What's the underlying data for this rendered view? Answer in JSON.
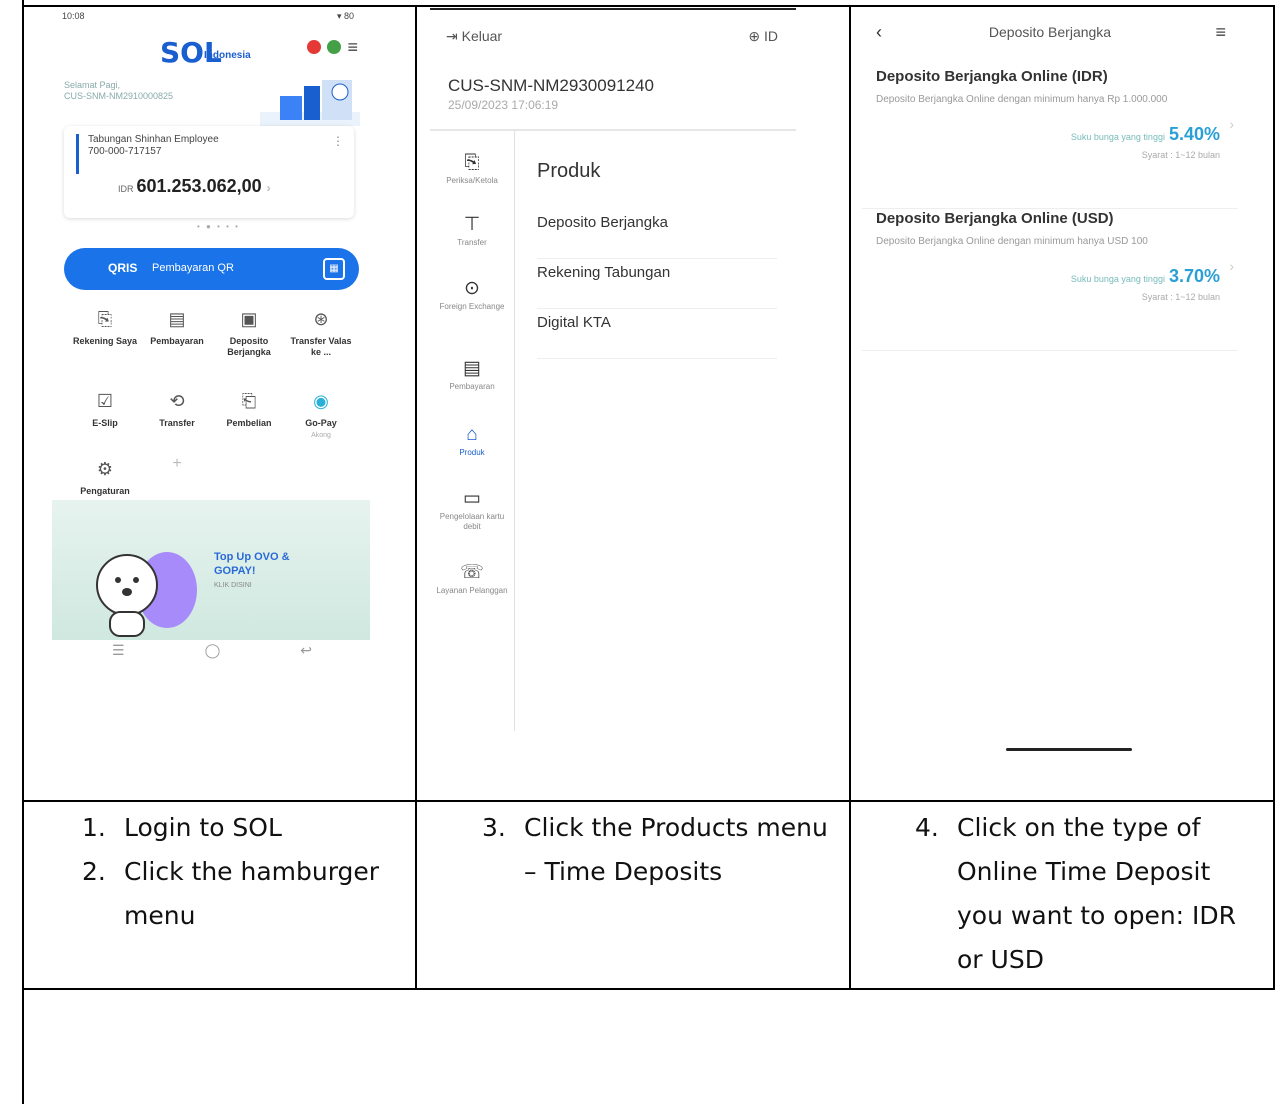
{
  "panel1": {
    "status_time": "10:08",
    "status_right": "▾ 80",
    "logo": "SOL",
    "logo_sub": "Indonesia",
    "greeting": "Selamat Pagi,",
    "user_id": "CUS-SNM-NM2910000825",
    "account_name": "Tabungan Shinhan Employee",
    "account_no": "700-000-717157",
    "currency": "IDR",
    "balance": "601.253.062,00",
    "qris_label": "QRIS",
    "qr_label": "Pembayaran QR",
    "menu": [
      {
        "label": "Rekening Saya",
        "icon": "search-doc-icon"
      },
      {
        "label": "Pembayaran",
        "icon": "bill-icon"
      },
      {
        "label": "Deposito Berjangka",
        "icon": "deposit-icon"
      },
      {
        "label": "Transfer Valas ke ...",
        "icon": "fx-icon"
      },
      {
        "label": "E-Slip",
        "icon": "checkbox-icon"
      },
      {
        "label": "Transfer",
        "icon": "transfer-icon"
      },
      {
        "label": "Pembelian",
        "icon": "purchase-icon"
      },
      {
        "label": "Go-Pay",
        "sub": "Akong",
        "icon": "gopay-icon"
      },
      {
        "label": "Pengaturan",
        "icon": "gear-icon"
      },
      {
        "label": "+",
        "icon": "plus-icon"
      }
    ],
    "promo_title": "Top Up OVO & GOPAY!",
    "promo_sub": "KLIK DISINI"
  },
  "panel2": {
    "logout": "Keluar",
    "lang": "ID",
    "cus_id": "CUS-SNM-NM2930091240",
    "datetime": "25/09/2023 17:06:19",
    "sidebar": [
      {
        "label": "Periksa/Ketola",
        "icon": "inquiry-icon"
      },
      {
        "label": "Transfer",
        "icon": "transfer-icon"
      },
      {
        "label": "Foreign Exchange",
        "icon": "exchange-icon"
      },
      {
        "label": "Pembayaran",
        "icon": "payment-icon"
      },
      {
        "label": "Produk",
        "icon": "product-icon"
      },
      {
        "label": "Pengelolaan kartu debit",
        "icon": "card-icon"
      },
      {
        "label": "Layanan Pelanggan",
        "icon": "support-icon"
      }
    ],
    "products_title": "Produk",
    "products": [
      "Deposito Berjangka",
      "Rekening Tabungan",
      "Digital KTA"
    ]
  },
  "panel3": {
    "title": "Deposito Berjangka",
    "deposits": [
      {
        "title": "Deposito Berjangka Online (IDR)",
        "desc": "Deposito Berjangka Online dengan minimum hanya Rp 1.000.000",
        "rate_label": "Suku bunga yang tinggi",
        "rate": "5.40%",
        "terms": "Syarat : 1~12 bulan"
      },
      {
        "title": "Deposito Berjangka Online (USD)",
        "desc": "Deposito Berjangka Online dengan minimum hanya USD 100",
        "rate_label": "Suku bunga yang tinggi",
        "rate": "3.70%",
        "terms": "Syarat : 1~12 bulan"
      }
    ]
  },
  "captions": {
    "c1": [
      {
        "n": "1.",
        "t": "Login to SOL"
      },
      {
        "n": "2.",
        "t": "Click the hamburger menu"
      }
    ],
    "c2": [
      {
        "n": "3.",
        "t": "Click the Products menu – Time Deposits"
      }
    ],
    "c3": [
      {
        "n": "4.",
        "t": "Click on the type of Online Time Deposit you want to open: IDR or USD"
      }
    ]
  }
}
